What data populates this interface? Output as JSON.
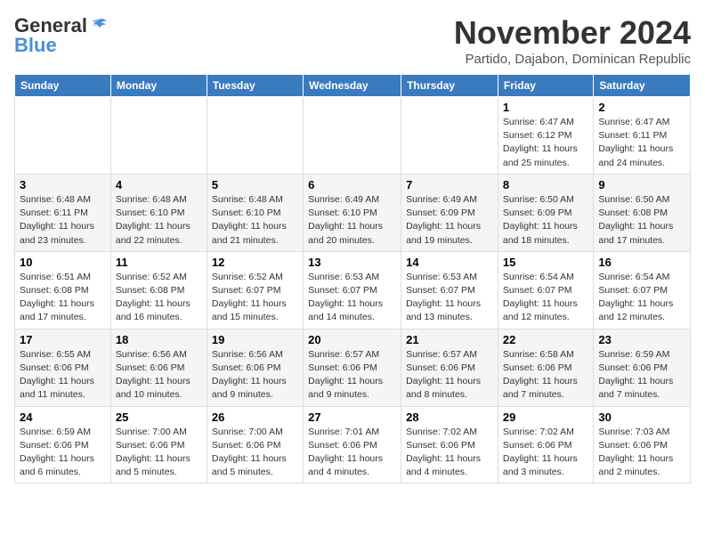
{
  "header": {
    "logo_general": "General",
    "logo_blue": "Blue",
    "title": "November 2024",
    "location": "Partido, Dajabon, Dominican Republic"
  },
  "calendar": {
    "days_of_week": [
      "Sunday",
      "Monday",
      "Tuesday",
      "Wednesday",
      "Thursday",
      "Friday",
      "Saturday"
    ],
    "weeks": [
      [
        {
          "day": "",
          "info": ""
        },
        {
          "day": "",
          "info": ""
        },
        {
          "day": "",
          "info": ""
        },
        {
          "day": "",
          "info": ""
        },
        {
          "day": "",
          "info": ""
        },
        {
          "day": "1",
          "info": "Sunrise: 6:47 AM\nSunset: 6:12 PM\nDaylight: 11 hours\nand 25 minutes."
        },
        {
          "day": "2",
          "info": "Sunrise: 6:47 AM\nSunset: 6:11 PM\nDaylight: 11 hours\nand 24 minutes."
        }
      ],
      [
        {
          "day": "3",
          "info": "Sunrise: 6:48 AM\nSunset: 6:11 PM\nDaylight: 11 hours\nand 23 minutes."
        },
        {
          "day": "4",
          "info": "Sunrise: 6:48 AM\nSunset: 6:10 PM\nDaylight: 11 hours\nand 22 minutes."
        },
        {
          "day": "5",
          "info": "Sunrise: 6:48 AM\nSunset: 6:10 PM\nDaylight: 11 hours\nand 21 minutes."
        },
        {
          "day": "6",
          "info": "Sunrise: 6:49 AM\nSunset: 6:10 PM\nDaylight: 11 hours\nand 20 minutes."
        },
        {
          "day": "7",
          "info": "Sunrise: 6:49 AM\nSunset: 6:09 PM\nDaylight: 11 hours\nand 19 minutes."
        },
        {
          "day": "8",
          "info": "Sunrise: 6:50 AM\nSunset: 6:09 PM\nDaylight: 11 hours\nand 18 minutes."
        },
        {
          "day": "9",
          "info": "Sunrise: 6:50 AM\nSunset: 6:08 PM\nDaylight: 11 hours\nand 17 minutes."
        }
      ],
      [
        {
          "day": "10",
          "info": "Sunrise: 6:51 AM\nSunset: 6:08 PM\nDaylight: 11 hours\nand 17 minutes."
        },
        {
          "day": "11",
          "info": "Sunrise: 6:52 AM\nSunset: 6:08 PM\nDaylight: 11 hours\nand 16 minutes."
        },
        {
          "day": "12",
          "info": "Sunrise: 6:52 AM\nSunset: 6:07 PM\nDaylight: 11 hours\nand 15 minutes."
        },
        {
          "day": "13",
          "info": "Sunrise: 6:53 AM\nSunset: 6:07 PM\nDaylight: 11 hours\nand 14 minutes."
        },
        {
          "day": "14",
          "info": "Sunrise: 6:53 AM\nSunset: 6:07 PM\nDaylight: 11 hours\nand 13 minutes."
        },
        {
          "day": "15",
          "info": "Sunrise: 6:54 AM\nSunset: 6:07 PM\nDaylight: 11 hours\nand 12 minutes."
        },
        {
          "day": "16",
          "info": "Sunrise: 6:54 AM\nSunset: 6:07 PM\nDaylight: 11 hours\nand 12 minutes."
        }
      ],
      [
        {
          "day": "17",
          "info": "Sunrise: 6:55 AM\nSunset: 6:06 PM\nDaylight: 11 hours\nand 11 minutes."
        },
        {
          "day": "18",
          "info": "Sunrise: 6:56 AM\nSunset: 6:06 PM\nDaylight: 11 hours\nand 10 minutes."
        },
        {
          "day": "19",
          "info": "Sunrise: 6:56 AM\nSunset: 6:06 PM\nDaylight: 11 hours\nand 9 minutes."
        },
        {
          "day": "20",
          "info": "Sunrise: 6:57 AM\nSunset: 6:06 PM\nDaylight: 11 hours\nand 9 minutes."
        },
        {
          "day": "21",
          "info": "Sunrise: 6:57 AM\nSunset: 6:06 PM\nDaylight: 11 hours\nand 8 minutes."
        },
        {
          "day": "22",
          "info": "Sunrise: 6:58 AM\nSunset: 6:06 PM\nDaylight: 11 hours\nand 7 minutes."
        },
        {
          "day": "23",
          "info": "Sunrise: 6:59 AM\nSunset: 6:06 PM\nDaylight: 11 hours\nand 7 minutes."
        }
      ],
      [
        {
          "day": "24",
          "info": "Sunrise: 6:59 AM\nSunset: 6:06 PM\nDaylight: 11 hours\nand 6 minutes."
        },
        {
          "day": "25",
          "info": "Sunrise: 7:00 AM\nSunset: 6:06 PM\nDaylight: 11 hours\nand 5 minutes."
        },
        {
          "day": "26",
          "info": "Sunrise: 7:00 AM\nSunset: 6:06 PM\nDaylight: 11 hours\nand 5 minutes."
        },
        {
          "day": "27",
          "info": "Sunrise: 7:01 AM\nSunset: 6:06 PM\nDaylight: 11 hours\nand 4 minutes."
        },
        {
          "day": "28",
          "info": "Sunrise: 7:02 AM\nSunset: 6:06 PM\nDaylight: 11 hours\nand 4 minutes."
        },
        {
          "day": "29",
          "info": "Sunrise: 7:02 AM\nSunset: 6:06 PM\nDaylight: 11 hours\nand 3 minutes."
        },
        {
          "day": "30",
          "info": "Sunrise: 7:03 AM\nSunset: 6:06 PM\nDaylight: 11 hours\nand 2 minutes."
        }
      ]
    ]
  }
}
